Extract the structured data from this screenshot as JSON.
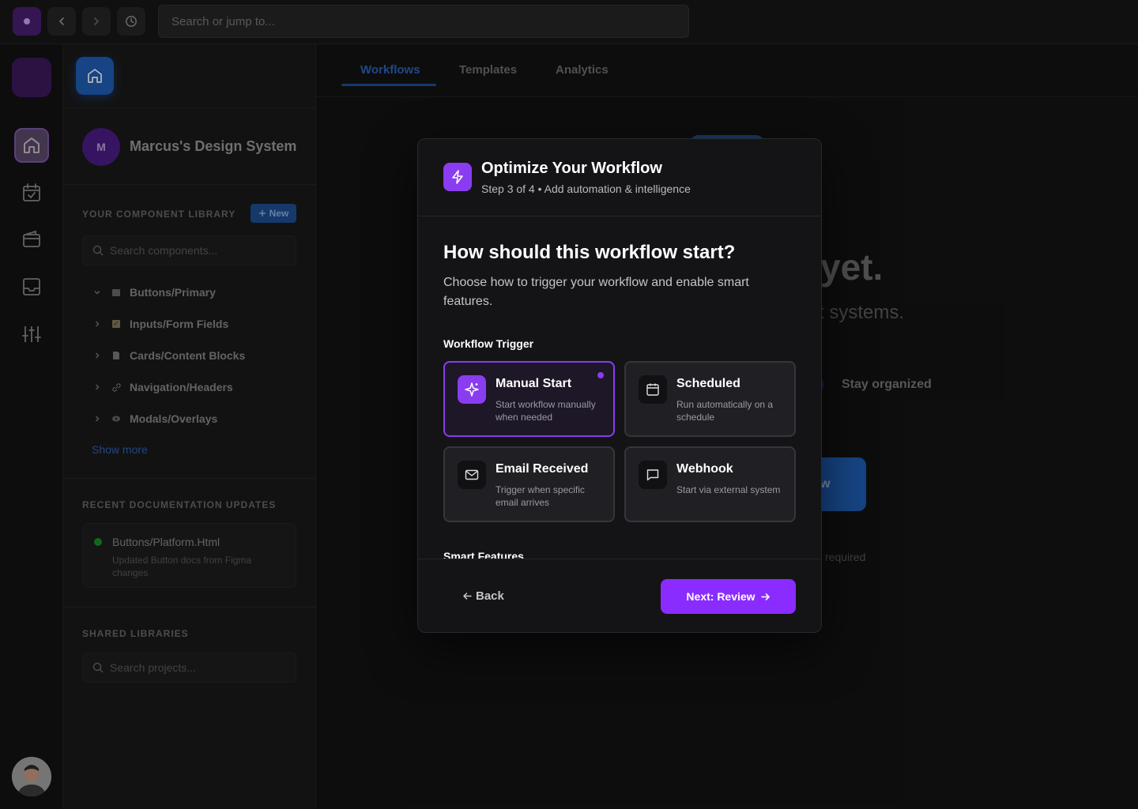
{
  "topbar": {
    "search_placeholder": "Search or jump to..."
  },
  "sidebar": {
    "workspace_initial": "M",
    "workspace_name": "Marcus's Design System",
    "library_label": "YOUR COMPONENT LIBRARY",
    "new_label": "New",
    "search_components_placeholder": "Search components...",
    "items": [
      {
        "label": "Buttons/Primary",
        "expanded": true,
        "icon": "folder-icon"
      },
      {
        "label": "Inputs/Form Fields",
        "expanded": false,
        "icon": "memo-icon"
      },
      {
        "label": "Cards/Content Blocks",
        "expanded": false,
        "icon": "page-icon"
      },
      {
        "label": "Navigation/Headers",
        "expanded": false,
        "icon": "link-icon"
      },
      {
        "label": "Modals/Overlays",
        "expanded": false,
        "icon": "eye-icon"
      }
    ],
    "show_more": "Show more",
    "recent_label": "RECENT DOCUMENTATION UPDATES",
    "recent_doc": {
      "title": "Buttons/Platform.Html",
      "subtitle": "Updated Button docs from Figma changes",
      "status_color": "#1a8f2a"
    },
    "shared_label": "SHARED LIBRARIES",
    "search_projects_placeholder": "Search projects..."
  },
  "main": {
    "tabs": [
      {
        "label": "Workflows",
        "active": true
      },
      {
        "label": "Templates",
        "active": false
      },
      {
        "label": "Analytics",
        "active": false
      }
    ],
    "bg_heading_fragment": "yet.",
    "bg_sub_fragment": "t systems.",
    "bg_feature": "Stay organized",
    "bg_cta_fragment": "w",
    "bg_note_fragment": "required"
  },
  "modal": {
    "title": "Optimize Your Workflow",
    "subtitle": "Step 3 of 4 • Add automation & intelligence",
    "question": "How should this workflow start?",
    "description": "Choose how to trigger your workflow and enable smart features.",
    "trigger_label": "Workflow Trigger",
    "options": [
      {
        "title": "Manual Start",
        "desc": "Start workflow manually when needed",
        "icon": "sparkle-icon",
        "selected": true
      },
      {
        "title": "Scheduled",
        "desc": "Run automatically on a schedule",
        "icon": "calendar-icon",
        "selected": false
      },
      {
        "title": "Email Received",
        "desc": "Trigger when specific email arrives",
        "icon": "mail-icon",
        "selected": false
      },
      {
        "title": "Webhook",
        "desc": "Start via external system",
        "icon": "message-icon",
        "selected": false
      }
    ],
    "smart_label": "Smart Features",
    "back_label": "Back",
    "next_label": "Next: Review"
  },
  "colors": {
    "accent": "#8a2cff",
    "brand_blue": "#1f5fb8"
  }
}
